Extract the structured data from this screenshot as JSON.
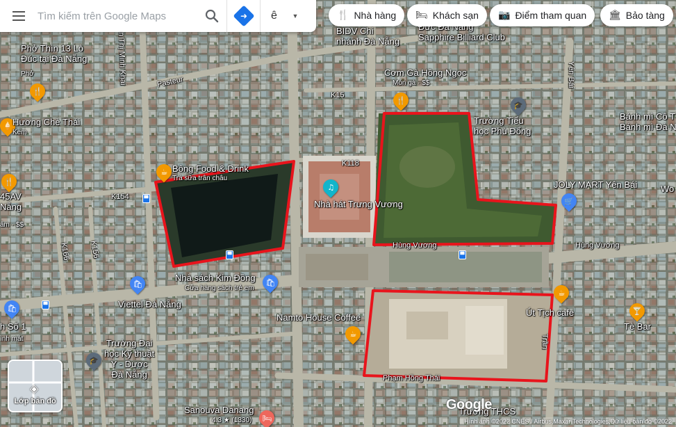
{
  "search": {
    "placeholder": "Tìm kiếm trên Google Maps",
    "menu_icon": "hamburger-icon",
    "search_icon": "magnifier-icon",
    "directions_icon": "directions-arrow-icon",
    "lang_label": "ê"
  },
  "chips": [
    {
      "label": "Nhà hàng",
      "icon": "fork-knife-icon",
      "glyph": "🍴"
    },
    {
      "label": "Khách sạn",
      "icon": "bed-icon",
      "glyph": "🛏"
    },
    {
      "label": "Điểm tham quan",
      "icon": "camera-icon",
      "glyph": "📷"
    },
    {
      "label": "Bảo tàng",
      "icon": "museum-icon",
      "glyph": "🏛"
    }
  ],
  "places": {
    "pho_thin": {
      "name": "Phở Thìn 13 Lò Đúc tại Đà Nẵng",
      "line1": "Phở Thìn 13 Lò",
      "line2": "Đúc tại Đà Nẵng",
      "category": "Phở"
    },
    "huong_che": {
      "name": "Hương Chè Thái",
      "category": "Kem"
    },
    "bong_food": {
      "name": "Bông Food & Drink",
      "category": "Trà sữa trân châu"
    },
    "bidv": {
      "line1": "BIDV Chi",
      "line2": "nhánh Đà Nẵng"
    },
    "billiard": {
      "line1": "Đức Đà Nẵng",
      "line2": "Sapphire Billiard Club"
    },
    "com_ga": {
      "name": "Cơm Gà Hồng Ngọc",
      "category": "Món gà · $$"
    },
    "truong_tieu_hoc": {
      "line1": "Trường Tiểu",
      "line2": "học Phù Đổng"
    },
    "banh_mi": {
      "line1": "Bánh mì Cô T",
      "line2": "Bánh mì Đà N"
    },
    "joly_mart": {
      "name": "JOLY MART Yên Bái"
    },
    "nha_hat": {
      "name": "Nhà hát Trưng Vương"
    },
    "nha_sach": {
      "name": "Nhà sách Kim Đồng",
      "category": "Cửa hàng sách trẻ em"
    },
    "viettel": {
      "name": "Viettel Đà Nẵng"
    },
    "namto": {
      "name": "Namto House Coffee"
    },
    "ut_tich": {
      "name": "Út Tịch cafe"
    },
    "te_bar": {
      "name": "Tè Bar"
    },
    "truong_dai_hoc": {
      "line1": "Trường Đại",
      "line2": "học Kỹ thuật",
      "line3": "Y - Dược",
      "line4": "Đà Nẵng"
    },
    "sanouva": {
      "name": "Sanouva Danang",
      "rating": "4.3 ★ (1330)"
    },
    "left_45av": {
      "line1": "45AV",
      "line2": "Nẵng",
      "line3": "âm · $$"
    },
    "left_so1": {
      "line1": "h Số 1",
      "line2": "ình mát"
    },
    "right_wo": {
      "name": "Wo"
    },
    "truong_thcs": {
      "name": "Trường THCS"
    }
  },
  "roads": {
    "pasteur": "Pasteur",
    "thi_minh_khai": "ễn Thị Minh Khai",
    "k15": "K15",
    "k118": "K118",
    "k154": "K154",
    "k166": "K166",
    "k156": "K156",
    "hung_vuong_1": "Hùng Vương",
    "hung_vuong_2": "Hùng Vương",
    "yen_bai": "Yên Bái",
    "pham_hong_thai": "Phạm Hồng Thái",
    "tran_bt": "Trần"
  },
  "layers": {
    "label": "Lớp bản đồ"
  },
  "logo": "Google",
  "attribution": "Hình ảnh ©2022 CNES / Airbus,Maxar Technologies,Dữ liệu bản đồ ©2022",
  "colors": {
    "highlight": "#e8141c",
    "pin_food": "#f29900",
    "pin_shop": "#4285f4",
    "pin_edu": "#5c6b7a"
  }
}
